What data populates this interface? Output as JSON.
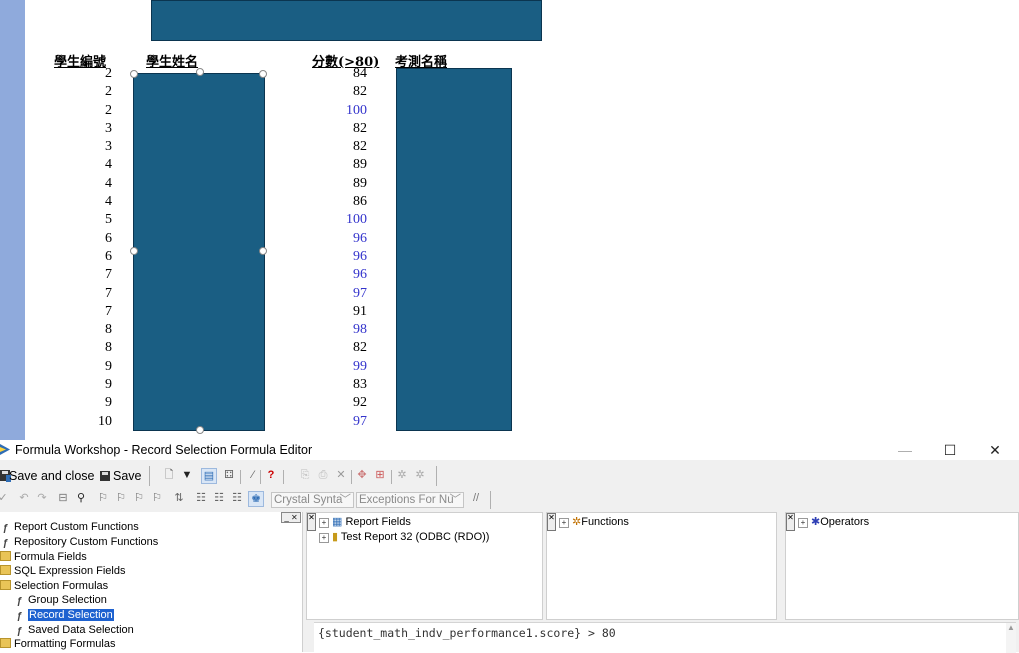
{
  "report": {
    "columns": {
      "student_id": "學生編號",
      "student_name": "學生姓名",
      "score": "分數(>80)",
      "exam_name": "考測名稱"
    },
    "student_ids": [
      "2",
      "2",
      "2",
      "3",
      "3",
      "4",
      "4",
      "4",
      "5",
      "6",
      "6",
      "7",
      "7",
      "7",
      "8",
      "8",
      "9",
      "9",
      "9",
      "10"
    ],
    "scores": [
      "84",
      "82",
      "100",
      "82",
      "82",
      "89",
      "89",
      "86",
      "100",
      "96",
      "96",
      "96",
      "97",
      "91",
      "98",
      "82",
      "99",
      "83",
      "92",
      "97"
    ],
    "score_highlight_color": "#3333cc"
  },
  "window": {
    "title": "Formula Workshop - Record Selection Formula Editor",
    "controls": {
      "minimize": "—",
      "maximize": "☐",
      "close": "✕"
    }
  },
  "toolbar": {
    "save_and_close": "Save and close",
    "save": "Save",
    "syntax_selected": "Crystal Synta",
    "exceptions_selected": "Exceptions For Nu",
    "comment_symbol": "//"
  },
  "tree": {
    "items": [
      {
        "label": "Report Custom Functions"
      },
      {
        "label": "Repository Custom Functions"
      },
      {
        "label": "Formula Fields"
      },
      {
        "label": "SQL Expression Fields"
      },
      {
        "label": "Selection Formulas"
      },
      {
        "label": "Group Selection"
      },
      {
        "label": "Record Selection"
      },
      {
        "label": "Saved Data Selection"
      },
      {
        "label": "Formatting Formulas"
      }
    ]
  },
  "fields_pane": {
    "items": [
      "Report Fields",
      "Test Report 32 (ODBC (RDO))"
    ]
  },
  "functions_pane": {
    "title": "Functions"
  },
  "operators_pane": {
    "title": "Operators"
  },
  "formula": {
    "text": "{student_math_indv_performance1.score} > 80"
  }
}
